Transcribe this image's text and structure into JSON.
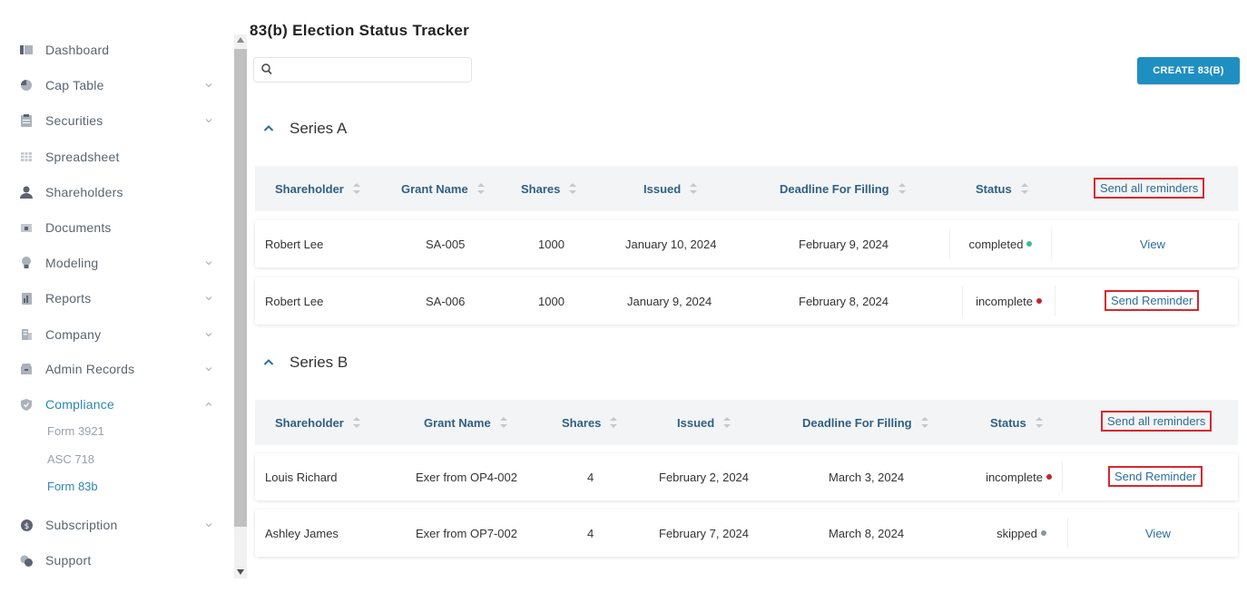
{
  "sidebar": {
    "items": [
      {
        "label": "Dashboard",
        "icon": "dashboard-icon"
      },
      {
        "label": "Cap Table",
        "icon": "pie-chart-icon"
      },
      {
        "label": "Securities",
        "icon": "clipboard-icon"
      },
      {
        "label": "Spreadsheet",
        "icon": "grid-icon"
      },
      {
        "label": "Shareholders",
        "icon": "user-icon"
      },
      {
        "label": "Documents",
        "icon": "folder-icon"
      },
      {
        "label": "Modeling",
        "icon": "lightbulb-icon"
      },
      {
        "label": "Reports",
        "icon": "report-icon"
      },
      {
        "label": "Company",
        "icon": "building-icon"
      },
      {
        "label": "Admin Records",
        "icon": "archive-icon"
      },
      {
        "label": "Compliance",
        "icon": "shield-icon"
      },
      {
        "label": "Subscription",
        "icon": "dollar-icon"
      },
      {
        "label": "Support",
        "icon": "support-icon"
      }
    ],
    "compliance_sub": [
      "Form 3921",
      "ASC 718",
      "Form 83b"
    ],
    "accent_color": "#2b86b3"
  },
  "main": {
    "title": "83(b) Election Status Tracker",
    "search": {
      "placeholder": "",
      "value": ""
    },
    "create_button": "CREATE 83(B)",
    "columns": [
      "Shareholder",
      "Grant Name",
      "Shares",
      "Issued",
      "Deadline For Filling",
      "Status"
    ],
    "send_all_label": "Send all reminders",
    "sections": [
      {
        "title": "Series A",
        "rows": [
          {
            "shareholder": "Robert Lee",
            "grant": "SA-005",
            "shares": "1000",
            "issued": "January 10, 2024",
            "deadline": "February 9, 2024",
            "status": "completed",
            "status_color": "#3fb8a0",
            "action": "View"
          },
          {
            "shareholder": "Robert Lee",
            "grant": "SA-006",
            "shares": "1000",
            "issued": "January 9, 2024",
            "deadline": "February 8, 2024",
            "status": "incomplete",
            "status_color": "#c0272d",
            "action": "Send Reminder"
          }
        ]
      },
      {
        "title": "Series B",
        "rows": [
          {
            "shareholder": "Louis Richard",
            "grant": "Exer from OP4-002",
            "shares": "4",
            "issued": "February 2, 2024",
            "deadline": "March 3, 2024",
            "status": "incomplete",
            "status_color": "#c0272d",
            "action": "Send Reminder"
          },
          {
            "shareholder": "Ashley James",
            "grant": "Exer from OP7-002",
            "shares": "4",
            "issued": "February 7, 2024",
            "deadline": "March 8, 2024",
            "status": "skipped",
            "status_color": "#8a96a3",
            "action": "View"
          }
        ]
      }
    ]
  }
}
